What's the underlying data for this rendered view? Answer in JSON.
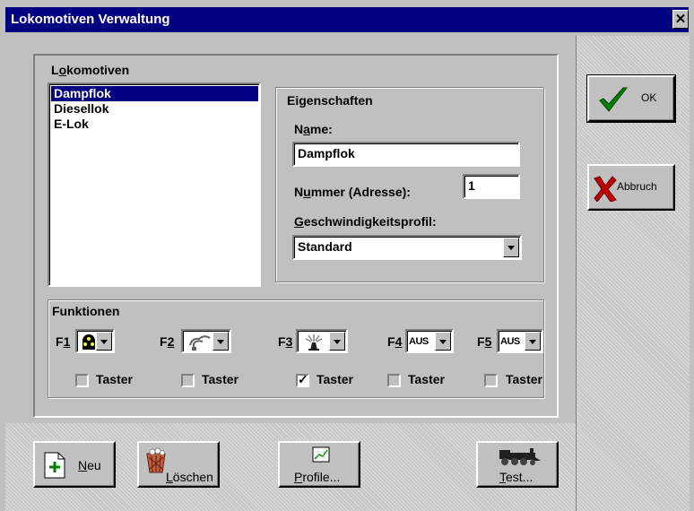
{
  "window": {
    "title": "Lokomotiven Verwaltung",
    "close_label": "✕"
  },
  "lokomotiven": {
    "group_label_pre": "L",
    "group_label_ul": "o",
    "group_label_post": "komotiven",
    "items": [
      "Dampflok",
      "Diesellok",
      "E-Lok"
    ],
    "selected": "Dampflok"
  },
  "eigenschaften": {
    "title": "Eigenschaften",
    "name_label_pre": "N",
    "name_label_ul": "a",
    "name_label_post": "me:",
    "name_value": "Dampflok",
    "nummer_label_pre": "N",
    "nummer_label_ul": "u",
    "nummer_label_post": "mmer (Adresse):",
    "nummer_value": "1",
    "profil_label_ul": "G",
    "profil_label_post": "eschwindigkeitsprofil:",
    "profil_value": "Standard"
  },
  "funktionen": {
    "title": "Funktionen",
    "items": [
      {
        "key_pre": "F",
        "key_ul": "1",
        "value": "",
        "icon": "light-icon",
        "taster_label": "Taster",
        "checked": false
      },
      {
        "key_pre": "F",
        "key_ul": "2",
        "value": "",
        "icon": "steam-icon",
        "taster_label": "Taster",
        "checked": false
      },
      {
        "key_pre": "F",
        "key_ul": "3",
        "value": "",
        "icon": "horn-icon",
        "taster_label": "Taster",
        "checked": true
      },
      {
        "key_pre": "F",
        "key_ul": "4",
        "value": "AUS",
        "icon": "",
        "taster_label": "Taster",
        "checked": false
      },
      {
        "key_pre": "F",
        "key_ul": "5",
        "value": "AUS",
        "icon": "",
        "taster_label": "Taster",
        "checked": false
      }
    ]
  },
  "buttons": {
    "ok": "OK",
    "abbruch": "Abbruch",
    "neu_ul": "N",
    "neu_post": "eu",
    "loeschen_ul": "L",
    "loeschen_post": "öschen",
    "profile_ul": "P",
    "profile_post": "rofile...",
    "test_ul": "T",
    "test_post": "est..."
  },
  "colors": {
    "titlebar": "#000080",
    "face": "#c0c0c0",
    "selection": "#000080",
    "ok_check": "#008000",
    "cancel_x": "#c00000"
  }
}
